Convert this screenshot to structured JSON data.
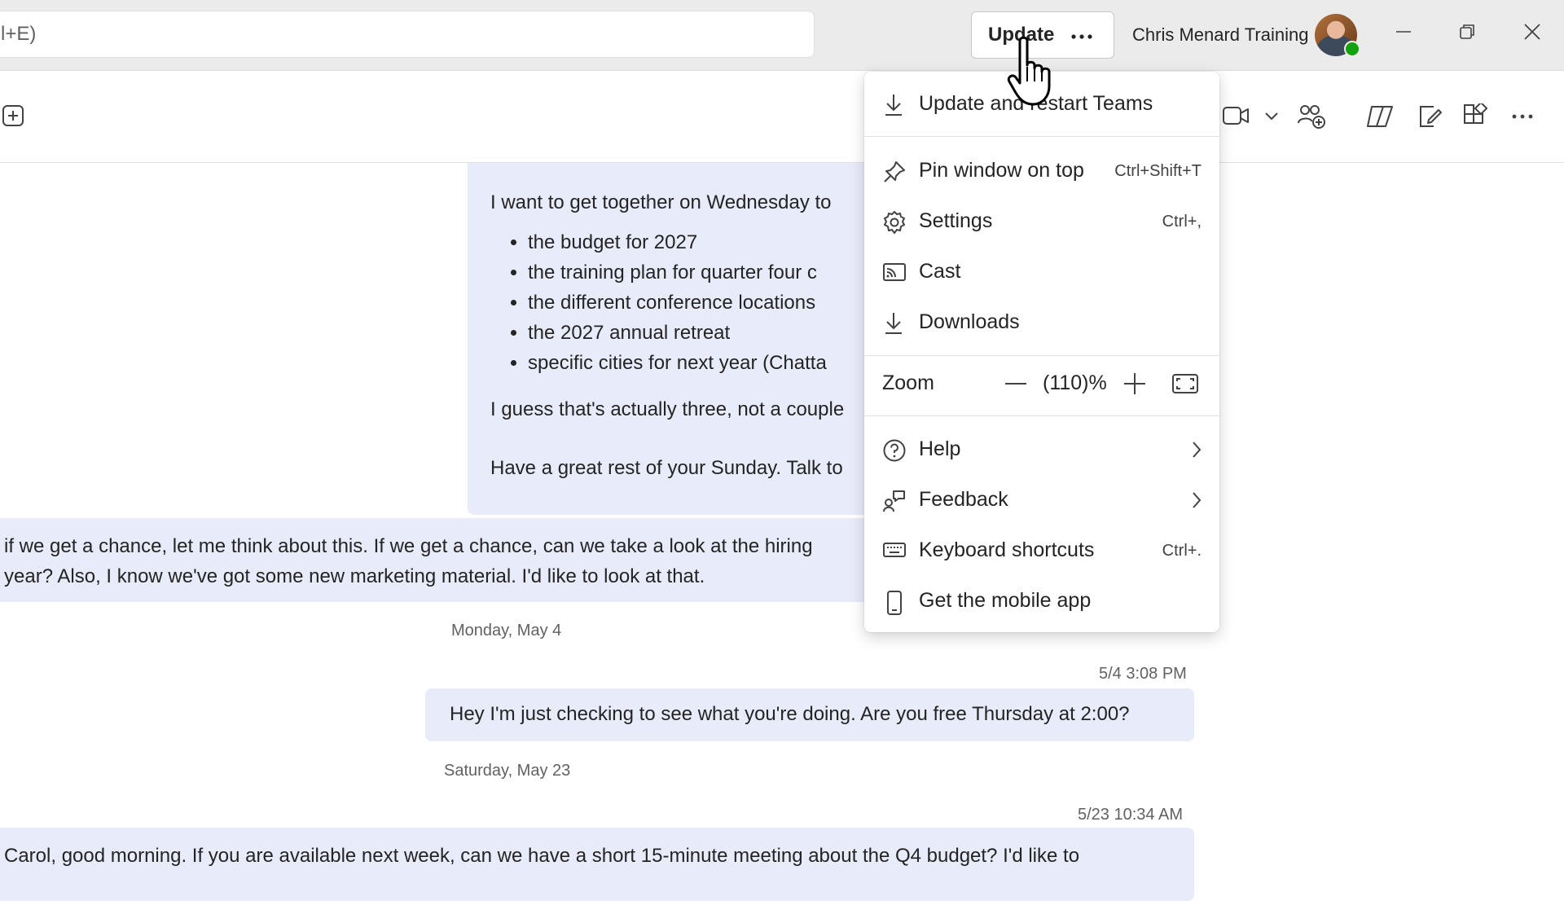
{
  "titlebar": {
    "search_text": "l+E)",
    "update_label": "Update",
    "profile_name": "Chris Menard Training"
  },
  "messages": {
    "long_message": {
      "intro": "I want to get together on Wednesday to",
      "bullets": [
        "the budget for 2027",
        "the training plan for quarter four c",
        "the different conference locations",
        "the 2027 annual retreat",
        "specific cities for next year (Chatta"
      ],
      "line2": "I guess that's actually three, not a couple",
      "line3": "Have a great rest of your Sunday. Talk to"
    },
    "reply": {
      "line1": "if we get a chance, let me think about this. If we get a chance, can we take a look at the hiring",
      "line2": "year? Also, I know we've got some new marketing material. I'd like to look at that."
    },
    "date1": "Monday, May 4",
    "time1": "5/4 3:08 PM",
    "msg1": "Hey I'm just checking to see what you're doing. Are you free Thursday at 2:00?",
    "date2": "Saturday, May 23",
    "time2": "5/23 10:34 AM",
    "msg2": "Carol, good morning. If you are available next week, can we have a short 15-minute meeting about the Q4 budget? I'd like to"
  },
  "menu": {
    "update_restart": "Update and restart Teams",
    "pin_window": "Pin window on top",
    "pin_shortcut": "Ctrl+Shift+T",
    "settings": "Settings",
    "settings_shortcut": "Ctrl+,",
    "cast": "Cast",
    "downloads": "Downloads",
    "zoom_label": "Zoom",
    "zoom_value": "(110)%",
    "help": "Help",
    "feedback": "Feedback",
    "keyboard_shortcuts": "Keyboard shortcuts",
    "keyboard_shortcut_key": "Ctrl+.",
    "mobile_app": "Get the mobile app"
  },
  "colors": {
    "titlebar_bg": "#ebebeb",
    "bubble_bg": "#e8ebfa",
    "presence": "#13a10e"
  }
}
